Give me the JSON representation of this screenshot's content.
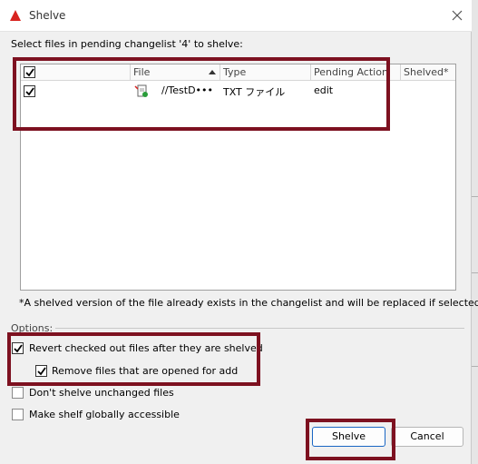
{
  "window": {
    "title": "Shelve"
  },
  "instruction": "Select files in pending changelist '4' to shelve:",
  "table": {
    "columns": [
      "File",
      "Type",
      "Pending Action",
      "Shelved*"
    ],
    "sorted_column": "File",
    "rows": [
      {
        "checked": true,
        "file": "//TestD•••",
        "type": "TXT ファイル",
        "pending_action": "edit",
        "shelved": ""
      }
    ]
  },
  "note": "*A shelved version of the file already exists in the changelist and will be replaced if selected",
  "options": {
    "group_label": "Options:",
    "revert_checked_out": {
      "label": "Revert checked out files after they are shelved",
      "checked": true
    },
    "remove_opened_for_add": {
      "label": "Remove files that are opened for add",
      "checked": true
    },
    "dont_shelve_unchanged": {
      "label": "Don't shelve unchanged files",
      "checked": false
    },
    "make_shelf_global": {
      "label": "Make shelf globally accessible",
      "checked": false
    }
  },
  "buttons": {
    "shelve": "Shelve",
    "cancel": "Cancel"
  },
  "colors": {
    "annotation_box": "#7d1120",
    "app_icon": "#d8231f",
    "default_button_border": "#1a67c4"
  },
  "icons": [
    "app-icon",
    "close-icon",
    "sort-ascending-icon",
    "file-edit-icon"
  ]
}
